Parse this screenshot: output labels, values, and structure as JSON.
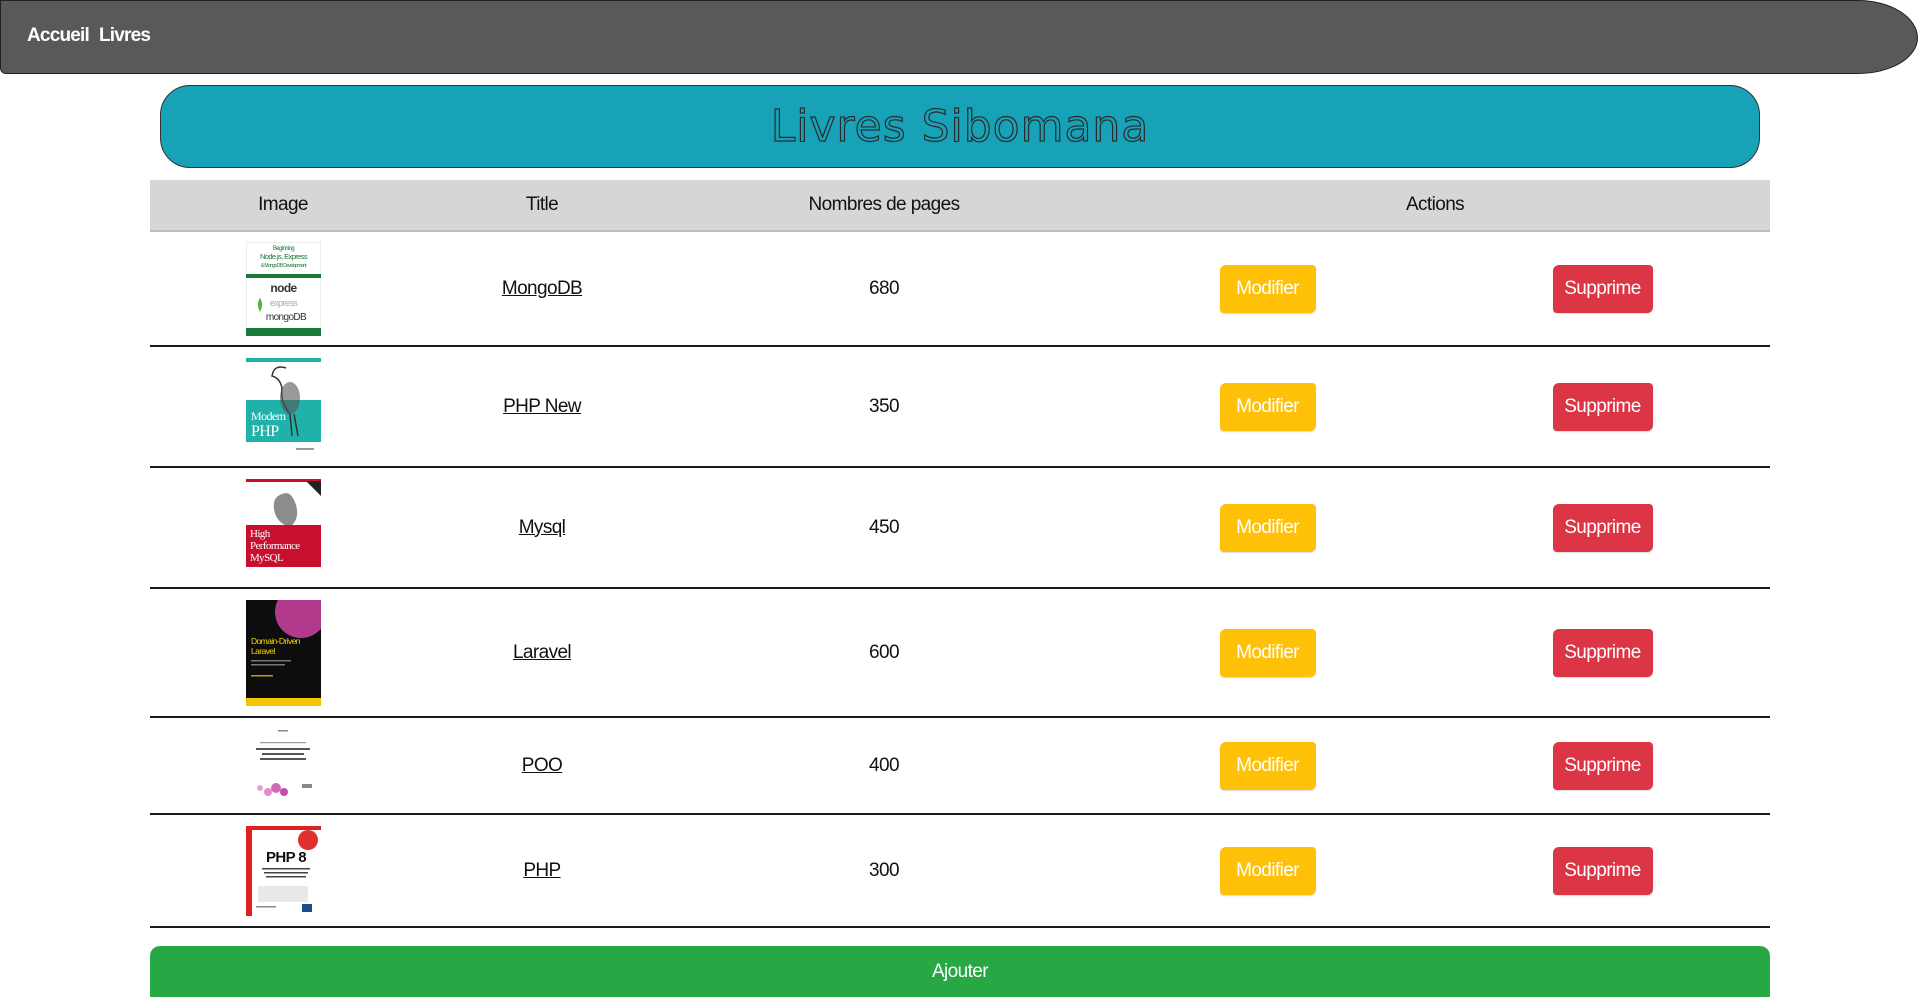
{
  "nav": {
    "links": [
      "Accueil",
      "Livres"
    ]
  },
  "page": {
    "title": "Livres Sibomana"
  },
  "table": {
    "headers": [
      "Image",
      "Title",
      "Nombres de pages",
      "Actions"
    ],
    "rows": [
      {
        "title": "MongoDB",
        "pages": "680",
        "cover": "nodejs-express-mongodb-cover"
      },
      {
        "title": "PHP New",
        "pages": "350",
        "cover": "modern-php-cover"
      },
      {
        "title": "Mysql",
        "pages": "450",
        "cover": "high-performance-mysql-cover"
      },
      {
        "title": "Laravel",
        "pages": "600",
        "cover": "domain-driven-laravel-cover"
      },
      {
        "title": "POO",
        "pages": "400",
        "cover": "php-poo-cover"
      },
      {
        "title": "PHP",
        "pages": "300",
        "cover": "php8-cover"
      }
    ],
    "edit_label": "Modifier",
    "delete_label": "Supprime"
  },
  "cover_texts": {
    "mongodb": {
      "top": "Beginning",
      "line1": "Node.js, Express",
      "line2": "& MongoDB Development",
      "node": "node",
      "express": "express",
      "mongo": "mongoDB"
    },
    "php_new": {
      "line1": "Modern",
      "line2": "PHP"
    },
    "mysql": {
      "line1": "High",
      "line2": "Performance",
      "line3": "MySQL"
    },
    "laravel": {
      "line1": "Domain-Driven",
      "line2": "Laravel"
    },
    "php8": {
      "line1": "PHP 8"
    }
  },
  "footer": {
    "add_label": "Ajouter"
  },
  "colors": {
    "navbar": "#595959",
    "banner": "#17a2b8",
    "modifier": "#ffc107",
    "supprime": "#dc3545",
    "ajouter": "#28a745",
    "header_row": "#d6d6d6"
  }
}
